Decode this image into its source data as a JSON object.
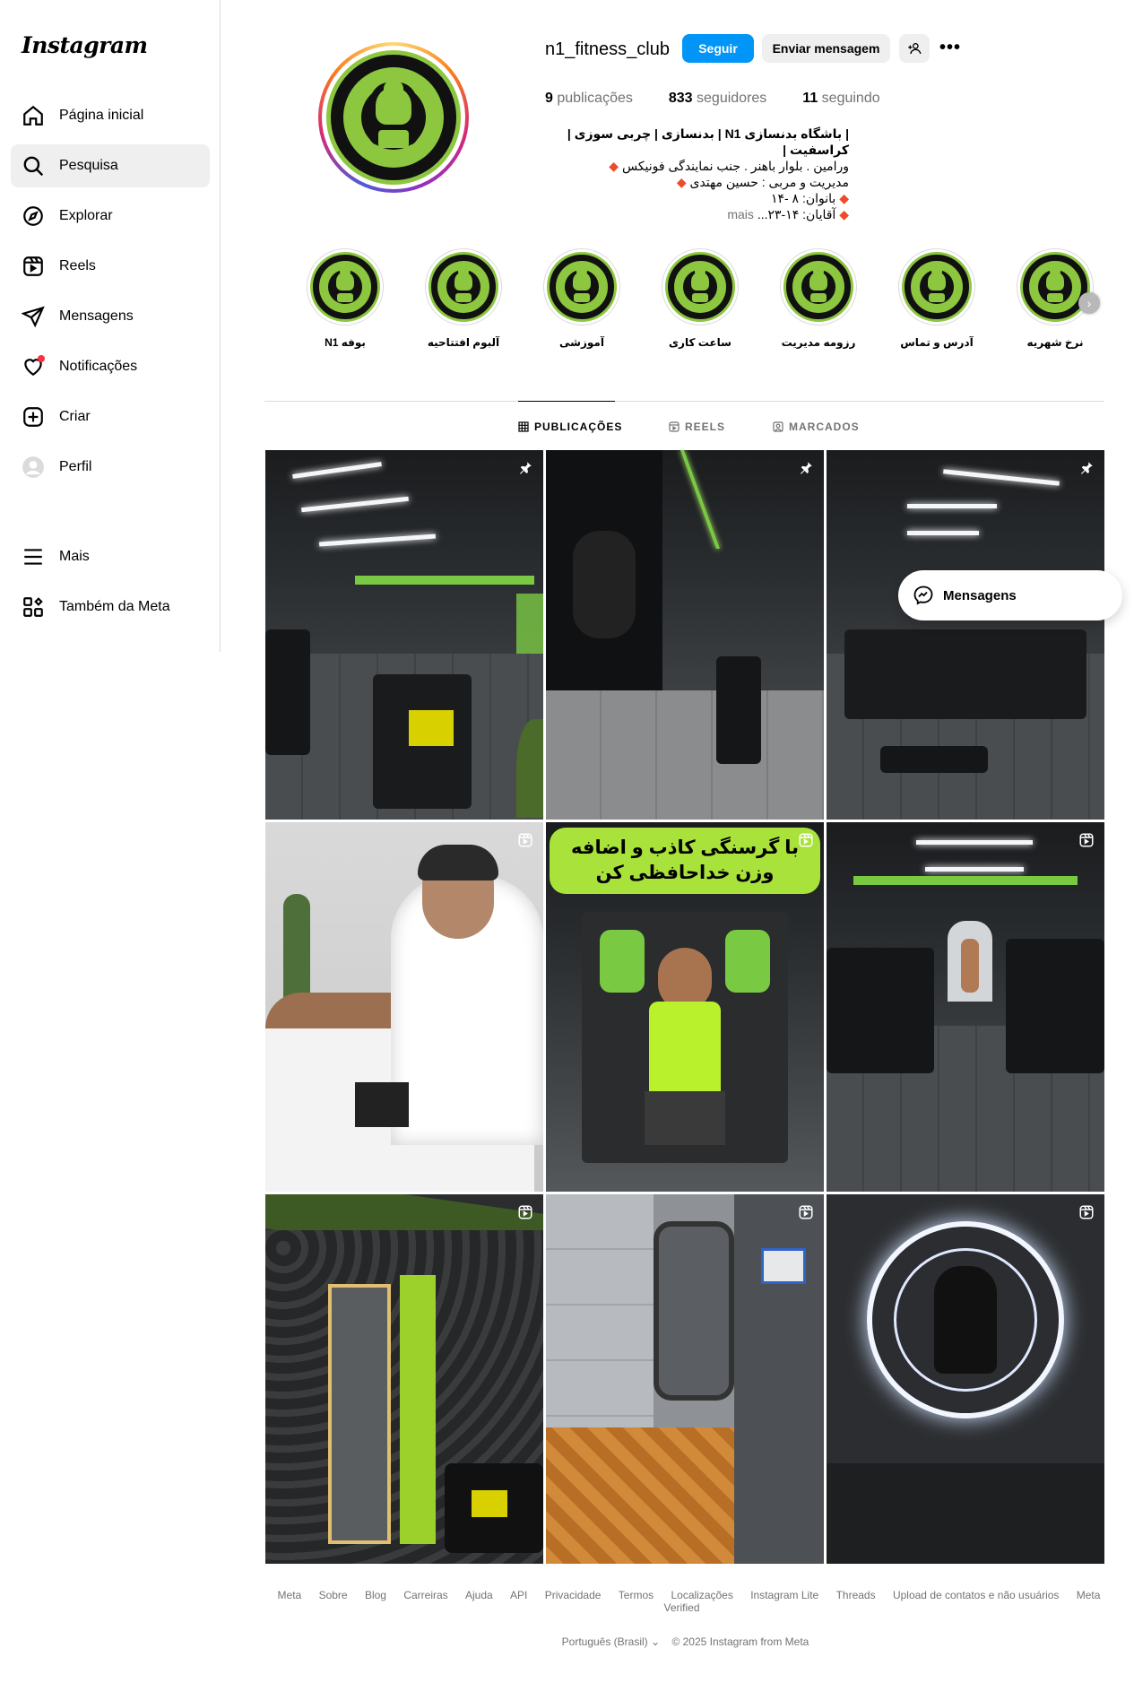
{
  "app": {
    "logo_text": "Instagram"
  },
  "sidebar": {
    "items": [
      {
        "label": "Página inicial",
        "icon": "home-icon"
      },
      {
        "label": "Pesquisa",
        "icon": "search-icon",
        "active": true
      },
      {
        "label": "Explorar",
        "icon": "compass-icon"
      },
      {
        "label": "Reels",
        "icon": "reels-icon"
      },
      {
        "label": "Mensagens",
        "icon": "send-icon"
      },
      {
        "label": "Notificações",
        "icon": "heart-icon"
      },
      {
        "label": "Criar",
        "icon": "plus-square-icon"
      },
      {
        "label": "Perfil",
        "icon": "avatar-icon"
      }
    ],
    "bottom_items": [
      {
        "label": "Mais",
        "icon": "menu-icon"
      },
      {
        "label": "Também da Meta",
        "icon": "meta-apps-icon"
      }
    ]
  },
  "profile": {
    "username": "n1_fitness_club",
    "follow_label": "Seguir",
    "message_label": "Enviar mensagem",
    "stats": {
      "posts_count": "9",
      "posts_label": "publicações",
      "followers_count": "833",
      "followers_label": "seguidores",
      "following_count": "11",
      "following_label": "seguindo"
    },
    "bio": {
      "line1": "| باشگاه بدنسازی N1 | بدنسازی | چربی سوزی | کراسفیت |",
      "line2": "ورامین . بلوار باهنر . جنب نمایندگی فونیکس",
      "line3": "مدیریت و مربی : حسین مهتدی",
      "line4": "بانوان: ۸ -۱۴",
      "line5": "آقایان: ۱۴-۲۳...",
      "more": "mais"
    }
  },
  "highlights": [
    {
      "label": "نرخ شهریه"
    },
    {
      "label": "آدرس و تماس"
    },
    {
      "label": "رزومه مدیریت"
    },
    {
      "label": "ساعت کاری"
    },
    {
      "label": "آموزشی"
    },
    {
      "label": "آلبوم افتتاحیه"
    },
    {
      "label": "بوفه N1"
    }
  ],
  "tabs": [
    {
      "label": "PUBLICAÇÕES",
      "icon": "grid-icon",
      "active": true
    },
    {
      "label": "REELS",
      "icon": "reels-icon"
    },
    {
      "label": "MARCADOS",
      "icon": "tagged-icon"
    }
  ],
  "posts": {
    "reel_text_line1": "با گرسنگی کاذب و اضافه",
    "reel_text_line2": "وزن خداحافظی کن"
  },
  "messages_popup": {
    "label": "Mensagens"
  },
  "footer": {
    "links": [
      "Meta",
      "Sobre",
      "Blog",
      "Carreiras",
      "Ajuda",
      "API",
      "Privacidade",
      "Termos",
      "Localizações",
      "Instagram Lite",
      "Threads",
      "Upload de contatos e não usuários",
      "Meta Verified"
    ],
    "language": "Português (Brasil)",
    "copyright": "© 2025 Instagram from Meta"
  },
  "colors": {
    "accent": "#0095f6",
    "brand_green": "#8dc63f"
  }
}
